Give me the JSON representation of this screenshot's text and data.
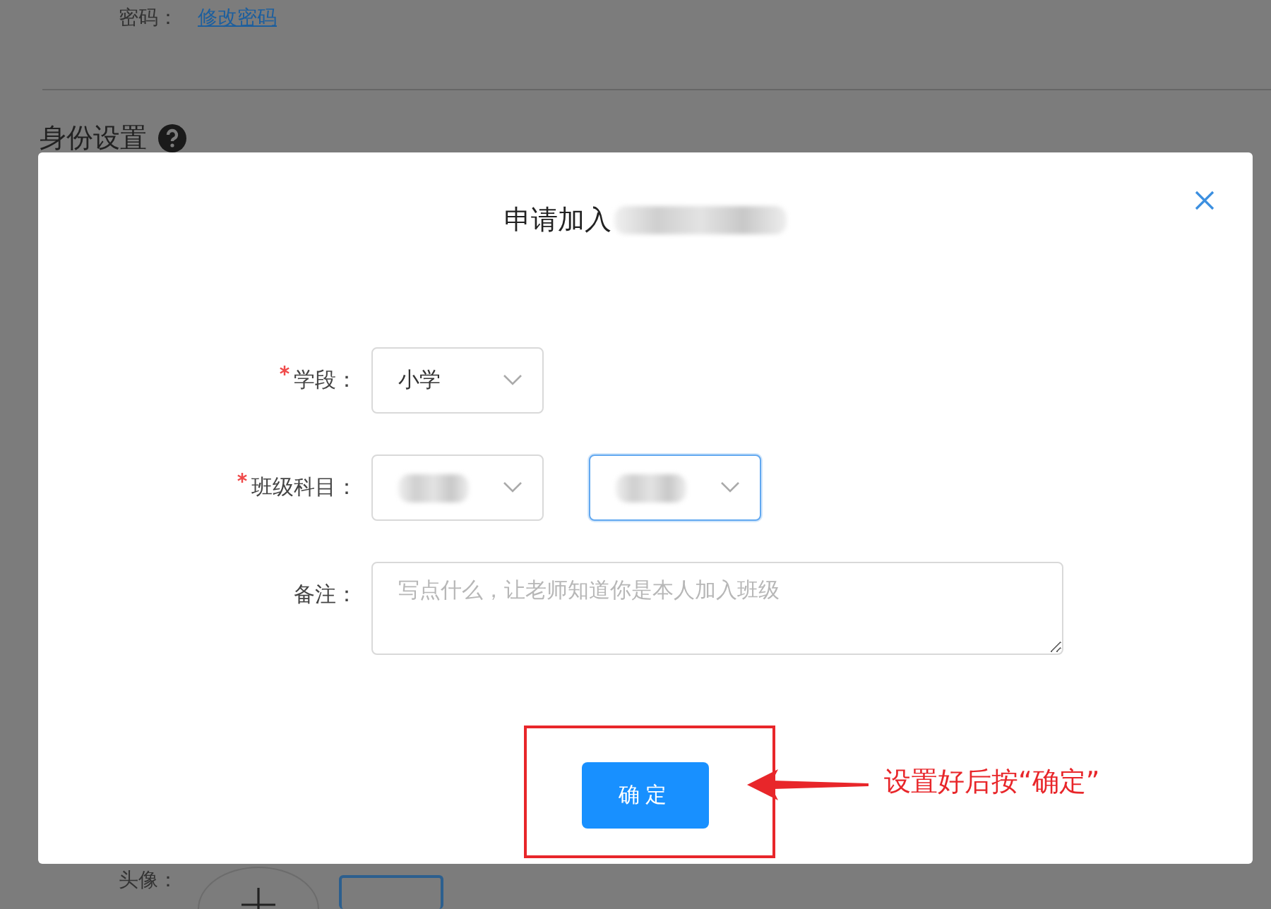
{
  "background_page": {
    "password_label": "密码：",
    "change_password_link": "修改密码",
    "section_title": "身份设置",
    "avatar_label": "头像："
  },
  "dialog": {
    "title": "申请加入",
    "fields": [
      {
        "label": "学段：",
        "required": true,
        "kind": "select",
        "selects": [
          {
            "value": "小学",
            "redacted": false,
            "focused": false
          }
        ]
      },
      {
        "label": "班级科目：",
        "required": true,
        "kind": "select",
        "selects": [
          {
            "redacted": true,
            "focused": false
          },
          {
            "redacted": true,
            "focused": true
          }
        ]
      },
      {
        "label": "备注：",
        "required": false,
        "kind": "textarea",
        "placeholder": "写点什么，让老师知道你是本人加入班级"
      }
    ],
    "confirm_button": "确定"
  },
  "annotation": {
    "text": "设置好后按“确定”"
  }
}
